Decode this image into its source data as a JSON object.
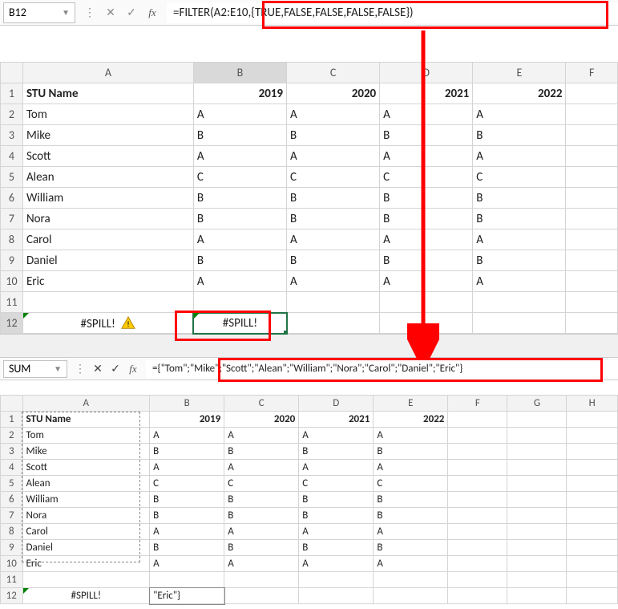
{
  "top": {
    "name_box": "B12",
    "formula": "=FILTER(A2:E10,{TRUE,FALSE,FALSE,FALSE,FALSE})",
    "columns": [
      "A",
      "B",
      "C",
      "D",
      "E",
      "F"
    ],
    "rows": [
      "1",
      "2",
      "3",
      "4",
      "5",
      "6",
      "7",
      "8",
      "9",
      "10",
      "11",
      "12"
    ],
    "headers": [
      "STU Name",
      "2019",
      "2020",
      "2021",
      "2022",
      ""
    ],
    "data": [
      [
        "Tom",
        "A",
        "A",
        "A",
        "A",
        ""
      ],
      [
        "Mike",
        "B",
        "B",
        "B",
        "B",
        ""
      ],
      [
        "Scott",
        "A",
        "A",
        "A",
        "A",
        ""
      ],
      [
        "Alean",
        "C",
        "C",
        "C",
        "C",
        ""
      ],
      [
        "William",
        "B",
        "B",
        "B",
        "B",
        ""
      ],
      [
        "Nora",
        "B",
        "B",
        "B",
        "B",
        ""
      ],
      [
        "Carol",
        "A",
        "A",
        "A",
        "A",
        ""
      ],
      [
        "Daniel",
        "B",
        "B",
        "B",
        "B",
        ""
      ],
      [
        "Eric",
        "A",
        "A",
        "A",
        "A",
        ""
      ]
    ],
    "spill_a12": "#SPILL!",
    "spill_b12": "#SPILL!"
  },
  "bottom": {
    "name_box": "SUM",
    "formula": "={\"Tom\";\"Mike\";\"Scott\";\"Alean\";\"William\";\"Nora\";\"Carol\";\"Daniel\";\"Eric\"}",
    "columns": [
      "A",
      "B",
      "C",
      "D",
      "E",
      "F",
      "G",
      "H"
    ],
    "rows": [
      "1",
      "2",
      "3",
      "4",
      "5",
      "6",
      "7",
      "8",
      "9",
      "10",
      "11",
      "12"
    ],
    "headers": [
      "STU Name",
      "2019",
      "2020",
      "2021",
      "2022",
      "",
      "",
      ""
    ],
    "data": [
      [
        "Tom",
        "A",
        "A",
        "A",
        "A",
        "",
        "",
        ""
      ],
      [
        "Mike",
        "B",
        "B",
        "B",
        "B",
        "",
        "",
        ""
      ],
      [
        "Scott",
        "A",
        "A",
        "A",
        "A",
        "",
        "",
        ""
      ],
      [
        "Alean",
        "C",
        "C",
        "C",
        "C",
        "",
        "",
        ""
      ],
      [
        "William",
        "B",
        "B",
        "B",
        "B",
        "",
        "",
        ""
      ],
      [
        "Nora",
        "B",
        "B",
        "B",
        "B",
        "",
        "",
        ""
      ],
      [
        "Carol",
        "A",
        "A",
        "A",
        "A",
        "",
        "",
        ""
      ],
      [
        "Daniel",
        "B",
        "B",
        "B",
        "B",
        "",
        "",
        ""
      ],
      [
        "Eric",
        "A",
        "A",
        "A",
        "A",
        "",
        "",
        ""
      ]
    ],
    "spill_a12": "#SPILL!",
    "edit_b12": "\"Eric\"}"
  }
}
